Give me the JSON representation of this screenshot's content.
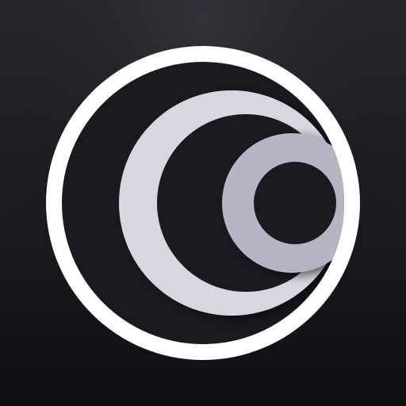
{
  "app_icon": {
    "name": "concentric-rings-logo",
    "colors": {
      "background_top": "#2a2a31",
      "background_bottom": "#0e0e12",
      "outer_ring": "#ffffff",
      "inner_disc": "#1a1920",
      "middle_ring": "#d9d6e0",
      "small_ring": "#b7b5c4",
      "core": "#1a1920"
    }
  }
}
